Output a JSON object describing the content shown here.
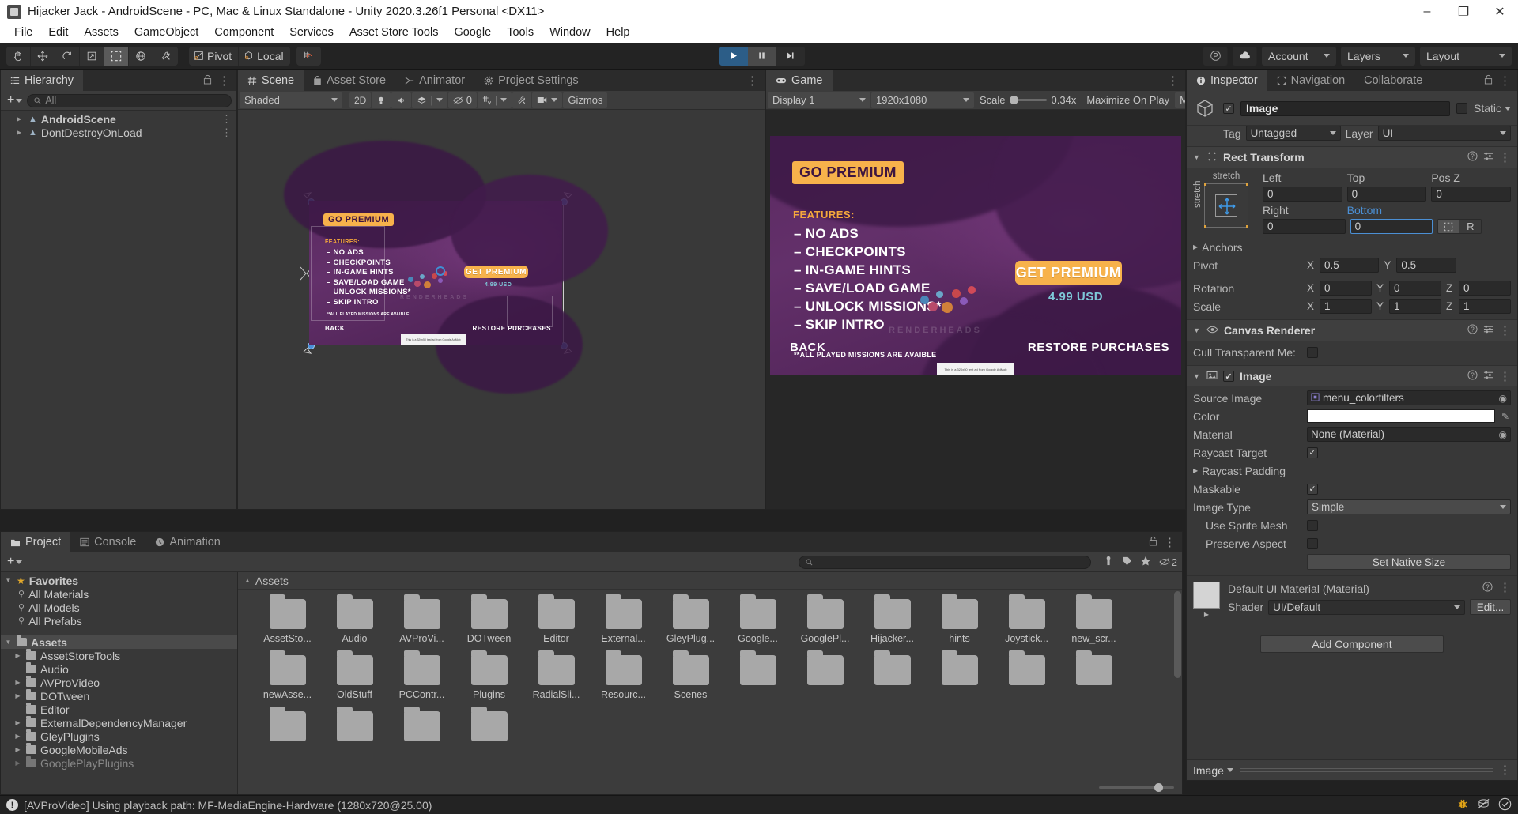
{
  "window": {
    "title": "Hijacker Jack - AndroidScene - PC, Mac & Linux Standalone - Unity 2020.3.26f1 Personal <DX11>",
    "minimize": "–",
    "maximize": "❐",
    "close": "✕"
  },
  "menu": [
    "File",
    "Edit",
    "Assets",
    "GameObject",
    "Component",
    "Services",
    "Asset Store Tools",
    "Google",
    "Tools",
    "Window",
    "Help"
  ],
  "toolbar": {
    "tools": [
      {
        "name": "hand-tool-icon",
        "selected": false
      },
      {
        "name": "move-tool-icon",
        "selected": false
      },
      {
        "name": "rotate-tool-icon",
        "selected": false
      },
      {
        "name": "scale-tool-icon",
        "selected": false
      },
      {
        "name": "rect-tool-icon",
        "selected": true
      },
      {
        "name": "transform-tool-icon",
        "selected": false
      },
      {
        "name": "custom-tool-icon",
        "selected": false
      }
    ],
    "pivot_label": "Pivot",
    "local_label": "Local",
    "grid_snap_name": "grid-snap-icon",
    "play_label": "▶",
    "pause_label": "▐▐",
    "step_label": "▶|",
    "cloud_name": "cloud-icon",
    "collab_name": "collab-icon",
    "account_label": "Account",
    "layers_label": "Layers",
    "layout_label": "Layout"
  },
  "hierarchy": {
    "tab": "Hierarchy",
    "search_placeholder": "All",
    "items": [
      {
        "label": "AndroidScene",
        "selected": false
      },
      {
        "label": "DontDestroyOnLoad",
        "selected": false
      }
    ]
  },
  "scene_panel": {
    "tabs": [
      {
        "label": "Scene",
        "icon": "grid-icon",
        "active": true
      },
      {
        "label": "Asset Store",
        "icon": "store-icon",
        "active": false
      },
      {
        "label": "Animator",
        "icon": "animator-icon",
        "active": false
      },
      {
        "label": "Project Settings",
        "icon": "gear-icon",
        "active": false
      }
    ],
    "toolbar": {
      "shading_mode": "Shaded",
      "mode_2d": "2D",
      "lighting_name": "lighting-icon",
      "audio_name": "audio-icon",
      "fx_name": "effects-icon",
      "hidden_count": "0",
      "grid_name": "grid-visibility-icon",
      "scene_tools_name": "scene-tools-icon",
      "camera_name": "scene-camera-icon",
      "gizmos_label": "Gizmos"
    }
  },
  "game_panel": {
    "tab": "Game",
    "toolbar": {
      "display": "Display 1",
      "resolution": "1920x1080",
      "scale_label": "Scale",
      "scale_value": "0.34x",
      "maximize_label": "Maximize On Play",
      "mute_label": "Mute"
    }
  },
  "premium_screen": {
    "title": "GO PREMIUM",
    "features_label": "FEATURES:",
    "features": [
      "– NO ADS",
      "– CHECKPOINTS",
      "– IN-GAME HINTS",
      "– SAVE/LOAD GAME",
      "– UNLOCK MISSIONS*",
      "– SKIP INTRO"
    ],
    "footnote": "**ALL PLAYED MISSIONS ARE AVAIBLE",
    "cta": "GET PREMIUM",
    "price": "4.99 USD",
    "back": "BACK",
    "restore": "RESTORE PURCHASES",
    "watermark": "RENDERHEADS",
    "ad_text": "This is a 320x50 test ad from Google AdMob",
    "colors": {
      "accent": "#f7b24b",
      "bg": "#5b2a62",
      "price": "#7ec8d8"
    }
  },
  "inspector": {
    "tabs": [
      {
        "label": "Inspector",
        "icon": "info-icon",
        "active": true
      },
      {
        "label": "Navigation",
        "icon": "navigation-icon",
        "active": false
      },
      {
        "label": "Collaborate",
        "icon": "",
        "active": false
      }
    ],
    "object_name": "Image",
    "enabled": true,
    "static_label": "Static",
    "tag_label": "Tag",
    "tag_value": "Untagged",
    "layer_label": "Layer",
    "layer_value": "UI",
    "rect_transform": {
      "title": "Rect Transform",
      "anchor_preset": "stretch",
      "anchor_preset_v": "stretch",
      "left_label": "Left",
      "left_value": "0",
      "top_label": "Top",
      "top_value": "0",
      "posz_label": "Pos Z",
      "posz_value": "0",
      "right_label": "Right",
      "right_value": "0",
      "bottom_label": "Bottom",
      "bottom_value": "0",
      "blueprint_name": "blueprint-mode-icon",
      "raw_label": "R",
      "anchors_label": "Anchors",
      "pivot_label": "Pivot",
      "pivot_x": "0.5",
      "pivot_y": "0.5",
      "rotation_label": "Rotation",
      "rot_x": "0",
      "rot_y": "0",
      "rot_z": "0",
      "scale_label": "Scale",
      "scale_x": "1",
      "scale_y": "1",
      "scale_z": "1"
    },
    "canvas_renderer": {
      "title": "Canvas Renderer",
      "cull_label": "Cull Transparent Me:",
      "cull_checked": false
    },
    "image": {
      "title": "Image",
      "enabled": true,
      "source_image_label": "Source Image",
      "source_image_value": "menu_colorfilters",
      "color_label": "Color",
      "color_value": "#FFFFFF",
      "material_label": "Material",
      "material_value": "None (Material)",
      "raycast_target_label": "Raycast Target",
      "raycast_target_checked": true,
      "raycast_padding_label": "Raycast Padding",
      "maskable_label": "Maskable",
      "maskable_checked": true,
      "image_type_label": "Image Type",
      "image_type_value": "Simple",
      "use_sprite_mesh_label": "Use Sprite Mesh",
      "use_sprite_mesh_checked": false,
      "preserve_aspect_label": "Preserve Aspect",
      "preserve_aspect_checked": false,
      "set_native_size_label": "Set Native Size"
    },
    "material": {
      "title": "Default UI Material (Material)",
      "shader_label": "Shader",
      "shader_value": "UI/Default",
      "edit_label": "Edit..."
    },
    "add_component_label": "Add Component",
    "footer_label": "Image"
  },
  "project": {
    "tabs": [
      {
        "label": "Project",
        "icon": "folder-icon",
        "active": true
      },
      {
        "label": "Console",
        "icon": "console-icon",
        "active": false
      },
      {
        "label": "Animation",
        "icon": "clock-icon",
        "active": false
      }
    ],
    "search_placeholder": "",
    "filter_icons": [
      "asset-type-filter-icon",
      "label-filter-icon",
      "favorite-filter-icon"
    ],
    "hidden_count": "2",
    "breadcrumb": "Assets",
    "tree": [
      {
        "label": "Favorites",
        "depth": 0,
        "arrow": "▼",
        "icon": "star",
        "bold": true
      },
      {
        "label": "All Materials",
        "depth": 1,
        "arrow": "",
        "icon": "search",
        "bold": false
      },
      {
        "label": "All Models",
        "depth": 1,
        "arrow": "",
        "icon": "search",
        "bold": false
      },
      {
        "label": "All Prefabs",
        "depth": 1,
        "arrow": "",
        "icon": "search",
        "bold": false
      },
      {
        "label": "",
        "depth": 0,
        "arrow": "",
        "icon": "none",
        "bold": false
      },
      {
        "label": "Assets",
        "depth": 0,
        "arrow": "▼",
        "icon": "folder",
        "bold": true,
        "selected": true
      },
      {
        "label": "AssetStoreTools",
        "depth": 1,
        "arrow": "▶",
        "icon": "folder",
        "bold": false
      },
      {
        "label": "Audio",
        "depth": 1,
        "arrow": "",
        "icon": "folder",
        "bold": false
      },
      {
        "label": "AVProVideo",
        "depth": 1,
        "arrow": "▶",
        "icon": "folder",
        "bold": false
      },
      {
        "label": "DOTween",
        "depth": 1,
        "arrow": "▶",
        "icon": "folder",
        "bold": false
      },
      {
        "label": "Editor",
        "depth": 1,
        "arrow": "",
        "icon": "folder",
        "bold": false
      },
      {
        "label": "ExternalDependencyManager",
        "depth": 1,
        "arrow": "▶",
        "icon": "folder",
        "bold": false
      },
      {
        "label": "GleyPlugins",
        "depth": 1,
        "arrow": "▶",
        "icon": "folder",
        "bold": false
      },
      {
        "label": "GoogleMobileAds",
        "depth": 1,
        "arrow": "▶",
        "icon": "folder",
        "bold": false
      },
      {
        "label": "GooglePlayPlugins",
        "depth": 1,
        "arrow": "▶",
        "icon": "folder",
        "bold": false
      }
    ],
    "assets": [
      "AssetSto...",
      "Audio",
      "AVProVi...",
      "DOTween",
      "Editor",
      "External...",
      "GleyPlug...",
      "Google...",
      "GooglePl...",
      "Hijacker...",
      "hints",
      "Joystick...",
      "new_scr...",
      "newAsse...",
      "OldStuff",
      "PCContr...",
      "Plugins",
      "RadialSli...",
      "Resourc...",
      "Scenes"
    ]
  },
  "status": {
    "message": "[AVProVideo] Using playback path: MF-MediaEngine-Hardware (1280x720@25.00)",
    "icons": [
      "bug-icon",
      "layers-disabled-icon",
      "check-circle-icon"
    ]
  }
}
